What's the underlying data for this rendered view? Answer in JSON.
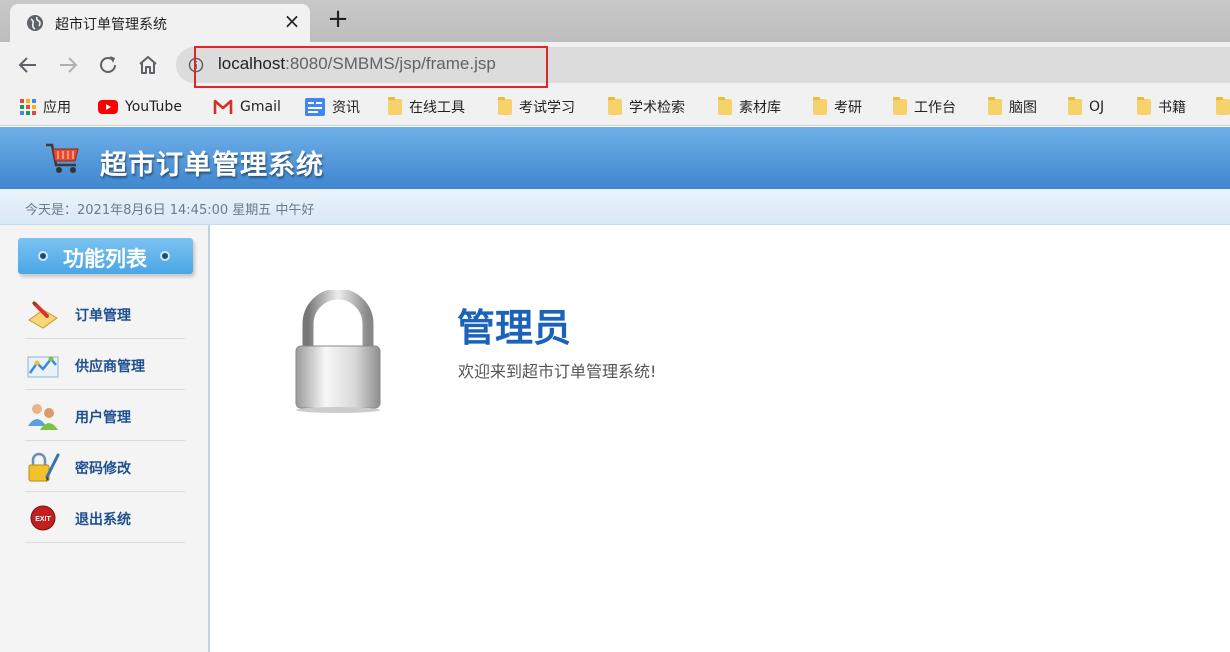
{
  "browser": {
    "tab": {
      "title": "超市订单管理系统",
      "close": "×"
    },
    "new_tab": "+",
    "url": {
      "host": "localhost",
      "rest": ":8080/SMBMS/jsp/frame.jsp"
    },
    "bookmarks": [
      {
        "label": "应用",
        "icon": "apps-grid-icon"
      },
      {
        "label": "YouTube",
        "icon": "youtube-icon"
      },
      {
        "label": "Gmail",
        "icon": "gmail-icon"
      },
      {
        "label": "资讯",
        "icon": "google-news-icon"
      },
      {
        "label": "在线工具",
        "icon": "folder-icon"
      },
      {
        "label": "考试学习",
        "icon": "folder-icon"
      },
      {
        "label": "学术检索",
        "icon": "folder-icon"
      },
      {
        "label": "素材库",
        "icon": "folder-icon"
      },
      {
        "label": "考研",
        "icon": "folder-icon"
      },
      {
        "label": "工作台",
        "icon": "folder-icon"
      },
      {
        "label": "脑图",
        "icon": "folder-icon"
      },
      {
        "label": "OJ",
        "icon": "folder-icon"
      },
      {
        "label": "书籍",
        "icon": "folder-icon"
      }
    ]
  },
  "header": {
    "title": "超市订单管理系统",
    "date_text": "今天是：2021年8月6日 14:45:00 星期五 中午好"
  },
  "sidebar": {
    "title": "功能列表",
    "items": [
      {
        "label": "订单管理",
        "icon": "order-icon"
      },
      {
        "label": "供应商管理",
        "icon": "supplier-icon"
      },
      {
        "label": "用户管理",
        "icon": "users-icon"
      },
      {
        "label": "密码修改",
        "icon": "password-icon"
      },
      {
        "label": "退出系统",
        "icon": "exit-icon"
      }
    ]
  },
  "main": {
    "role": "管理员",
    "welcome": "欢迎来到超市订单管理系统!",
    "exit_badge": "EXIT"
  },
  "colors": {
    "accent": "#3f86cf",
    "highlight": "#e0262b",
    "link": "#1d4f91",
    "role": "#1b63b8"
  }
}
